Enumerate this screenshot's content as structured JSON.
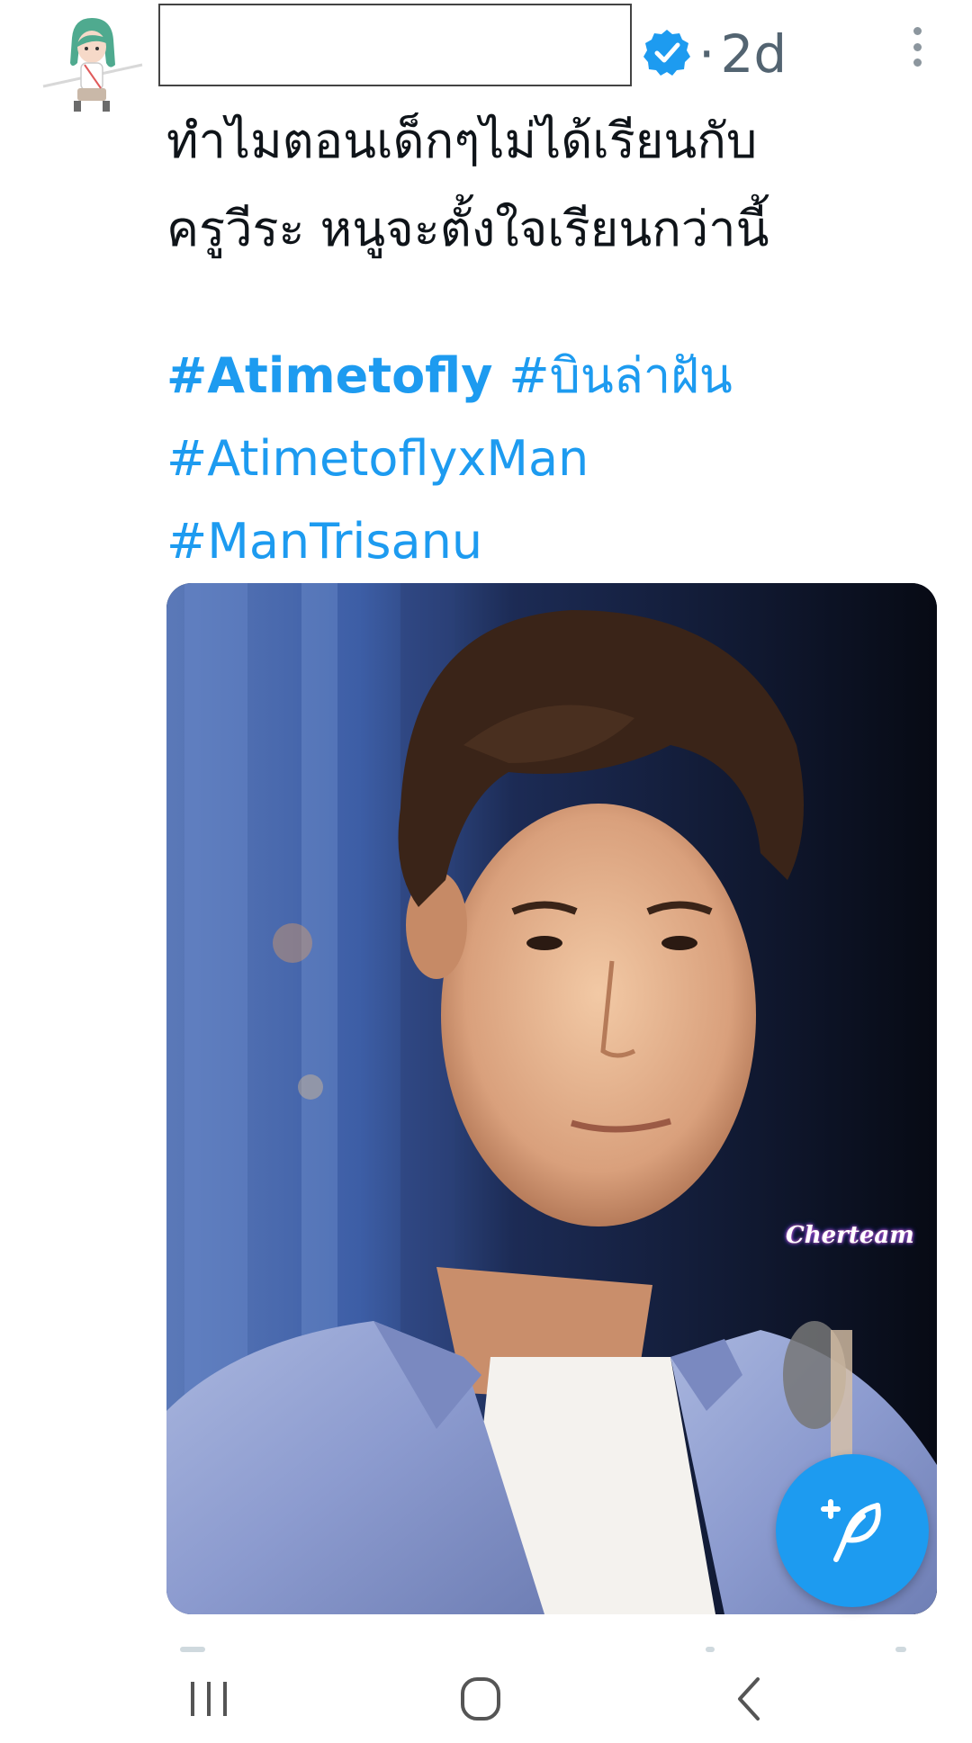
{
  "tweet": {
    "timestamp": "2d",
    "separator": "·",
    "text_line1": "ทำไมตอนเด็กๆไม่ได้เรียนกับ",
    "text_line2": "ครูวีระ หนูจะตั้งใจเรียนกว่านี้",
    "hashtags": [
      "#Atimetofly",
      "#บินล่าฝัน",
      "#AtimetoflyxMan",
      "#ManTrisanu"
    ],
    "media": {
      "watermark": "Cherteam"
    },
    "verified_color": "#1d9bf0"
  },
  "colors": {
    "link": "#1d9bf0",
    "text": "#0f1419",
    "muted": "#536471"
  },
  "icons": {
    "avatar": "avatar-illustration",
    "verified": "verified-badge-icon",
    "more": "more-vertical-icon",
    "compose": "compose-tweet-icon",
    "nav_recents": "recents-icon",
    "nav_home": "home-icon",
    "nav_back": "back-icon"
  }
}
